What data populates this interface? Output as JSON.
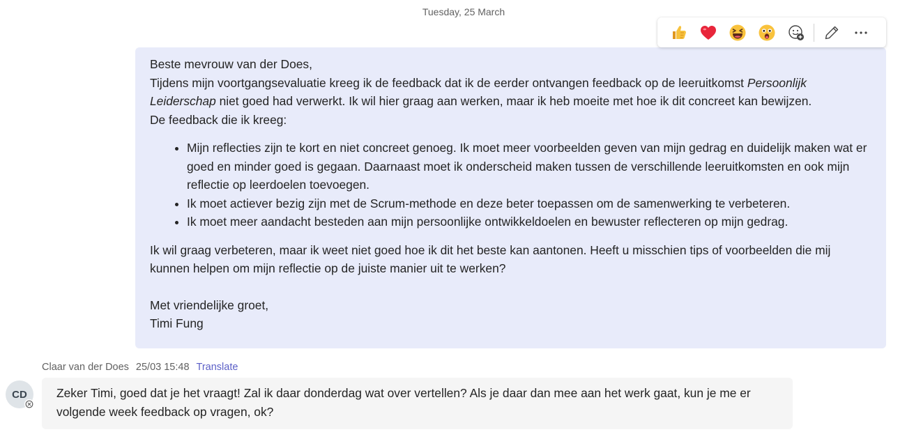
{
  "date_divider": "Tuesday, 25 March",
  "reaction_bar": {
    "reactions": [
      "like-emoji",
      "heart-emoji",
      "laugh-emoji",
      "surprised-emoji"
    ],
    "icons": [
      "add-reaction-icon",
      "edit-icon",
      "more-options-icon"
    ]
  },
  "own_message": {
    "greeting": "Beste mevrouw van der Does,",
    "intro_before_italic": "Tijdens mijn voortgangsevaluatie kreeg ik de feedback dat ik de eerder ontvangen feedback op de leeruitkomst ",
    "intro_italic": "Persoonlijk Leiderschap",
    "intro_after_italic": " niet goed had verwerkt. Ik wil hier graag aan werken, maar ik heb moeite met hoe ik dit concreet kan bewijzen.",
    "feedback_line": "De feedback die ik kreeg:",
    "bullets": [
      "Mijn reflecties zijn te kort en niet concreet genoeg. Ik moet meer voorbeelden geven van mijn gedrag en duidelijk maken wat er goed en minder goed is gegaan. Daarnaast moet ik onderscheid maken tussen de verschillende leeruitkomsten en ook mijn reflectie op leerdoelen toevoegen.",
      "Ik moet actiever bezig zijn met de Scrum-methode en deze beter toepassen om de samenwerking te verbeteren.",
      "Ik moet meer aandacht besteden aan mijn persoonlijke ontwikkeldoelen en bewuster reflecteren op mijn gedrag."
    ],
    "closing_paragraph": "Ik wil graag verbeteren, maar ik weet niet goed hoe ik dit het beste kan aantonen. Heeft u misschien tips of voorbeelden die mij kunnen helpen om mijn reflectie op de juiste manier uit te werken?",
    "sign_off": "Met vriendelijke groet,",
    "signature": "Timi Fung"
  },
  "reply": {
    "sender": "Claar van der Does",
    "timestamp": "25/03 15:48",
    "translate_label": "Translate",
    "avatar_initials": "CD",
    "text": "Zeker Timi, goed dat je het vraagt! Zal ik daar donderdag wat over vertellen? Als je daar dan mee aan het werk gaat, kun je me er volgende week feedback op vragen, ok?"
  },
  "colors": {
    "own_bubble": "#e8ebfa",
    "reply_bubble": "#f5f5f5",
    "link": "#5b5fc7"
  }
}
